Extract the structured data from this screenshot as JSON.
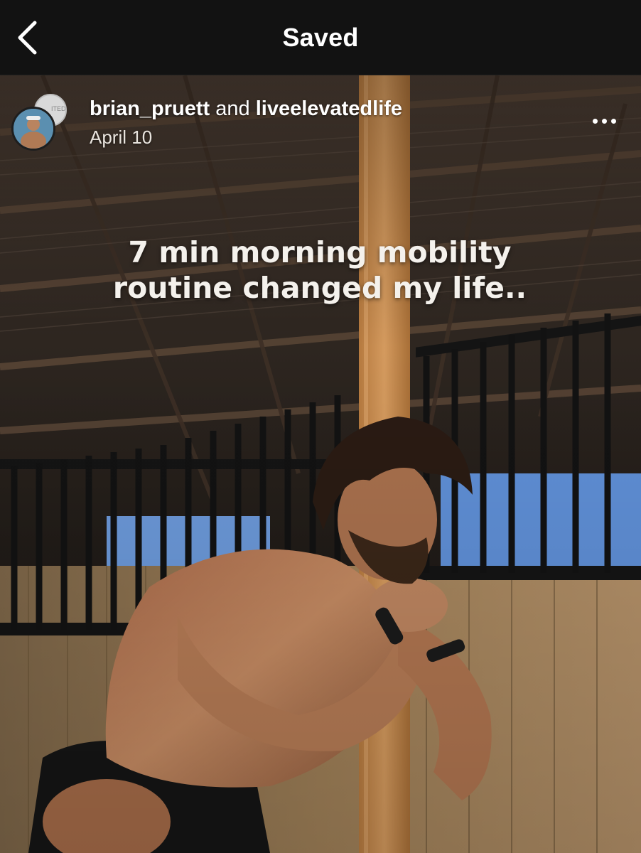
{
  "header": {
    "title": "Saved",
    "back_icon": "chevron-left-icon"
  },
  "post": {
    "author": "brian_pruett",
    "conjunction": "and",
    "collaborator": "liveelevatedlife",
    "date": "April 10",
    "more_icon": "more-horizontal-icon",
    "avatar_back_text": "ITED"
  },
  "media": {
    "caption_line1": "7 min morning mobility",
    "caption_line2": "routine changed my life..",
    "colors": {
      "roof": "#3a2f28",
      "beam": "#c58a4d",
      "railing": "#151515",
      "wall": "#a68458",
      "sky": "#5f8fd6",
      "skin": "#b87a55",
      "hair": "#2b1d15",
      "shorts": "#141414"
    }
  }
}
